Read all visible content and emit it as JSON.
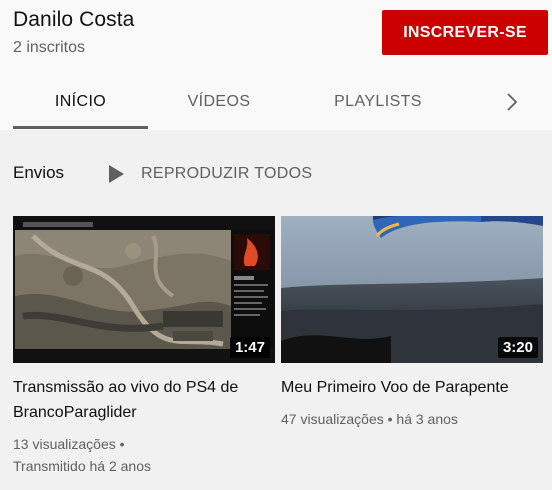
{
  "channel": {
    "name": "Danilo Costa",
    "subscribers": "2 inscritos",
    "subscribe_label": "INSCREVER-SE"
  },
  "tabs": [
    {
      "label": "INÍCIO",
      "active": true
    },
    {
      "label": "VÍDEOS",
      "active": false
    },
    {
      "label": "PLAYLISTS",
      "active": false
    }
  ],
  "icons": {
    "tab_scroll": "chevron-right-icon",
    "play_all": "play-icon"
  },
  "section": {
    "title": "Envios",
    "play_all_label": "REPRODUZIR TODOS"
  },
  "videos": [
    {
      "title": "Transmissão ao vivo do PS4 de BrancoParaglider",
      "views": "13 visualizações",
      "separator": "•",
      "age": "Transmitido há 2 anos",
      "duration": "1:47",
      "thumbnail": "aerial-canyon-livestream"
    },
    {
      "title": "Meu Primeiro Voo de Parapente",
      "views": "47 visualizações",
      "separator": "•",
      "age": "há 3 anos",
      "duration": "3:20",
      "thumbnail": "paraglider-wing-over-valley"
    }
  ],
  "colors": {
    "subscribe_bg": "#cc0000",
    "page_bg": "#f1f1f1",
    "header_bg": "#f9f9f9",
    "secondary_text": "#606060"
  }
}
